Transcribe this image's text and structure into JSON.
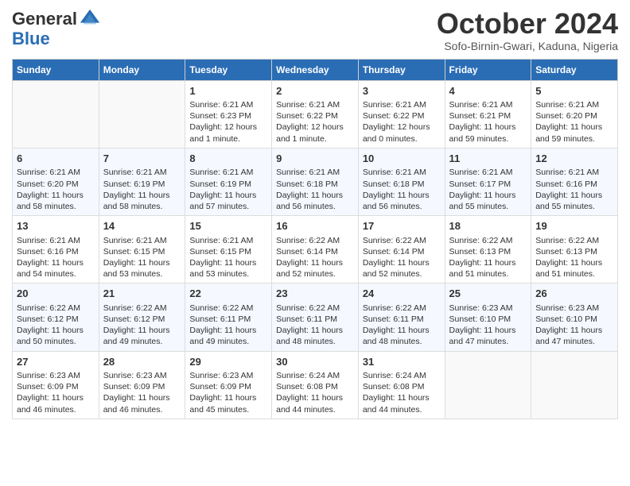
{
  "header": {
    "logo_general": "General",
    "logo_blue": "Blue",
    "month_title": "October 2024",
    "subtitle": "Sofo-Birnin-Gwari, Kaduna, Nigeria"
  },
  "days_of_week": [
    "Sunday",
    "Monday",
    "Tuesday",
    "Wednesday",
    "Thursday",
    "Friday",
    "Saturday"
  ],
  "weeks": [
    [
      {
        "day": null
      },
      {
        "day": null
      },
      {
        "day": 1,
        "sunrise": "Sunrise: 6:21 AM",
        "sunset": "Sunset: 6:23 PM",
        "daylight": "Daylight: 12 hours and 1 minute."
      },
      {
        "day": 2,
        "sunrise": "Sunrise: 6:21 AM",
        "sunset": "Sunset: 6:22 PM",
        "daylight": "Daylight: 12 hours and 1 minute."
      },
      {
        "day": 3,
        "sunrise": "Sunrise: 6:21 AM",
        "sunset": "Sunset: 6:22 PM",
        "daylight": "Daylight: 12 hours and 0 minutes."
      },
      {
        "day": 4,
        "sunrise": "Sunrise: 6:21 AM",
        "sunset": "Sunset: 6:21 PM",
        "daylight": "Daylight: 11 hours and 59 minutes."
      },
      {
        "day": 5,
        "sunrise": "Sunrise: 6:21 AM",
        "sunset": "Sunset: 6:20 PM",
        "daylight": "Daylight: 11 hours and 59 minutes."
      }
    ],
    [
      {
        "day": 6,
        "sunrise": "Sunrise: 6:21 AM",
        "sunset": "Sunset: 6:20 PM",
        "daylight": "Daylight: 11 hours and 58 minutes."
      },
      {
        "day": 7,
        "sunrise": "Sunrise: 6:21 AM",
        "sunset": "Sunset: 6:19 PM",
        "daylight": "Daylight: 11 hours and 58 minutes."
      },
      {
        "day": 8,
        "sunrise": "Sunrise: 6:21 AM",
        "sunset": "Sunset: 6:19 PM",
        "daylight": "Daylight: 11 hours and 57 minutes."
      },
      {
        "day": 9,
        "sunrise": "Sunrise: 6:21 AM",
        "sunset": "Sunset: 6:18 PM",
        "daylight": "Daylight: 11 hours and 56 minutes."
      },
      {
        "day": 10,
        "sunrise": "Sunrise: 6:21 AM",
        "sunset": "Sunset: 6:18 PM",
        "daylight": "Daylight: 11 hours and 56 minutes."
      },
      {
        "day": 11,
        "sunrise": "Sunrise: 6:21 AM",
        "sunset": "Sunset: 6:17 PM",
        "daylight": "Daylight: 11 hours and 55 minutes."
      },
      {
        "day": 12,
        "sunrise": "Sunrise: 6:21 AM",
        "sunset": "Sunset: 6:16 PM",
        "daylight": "Daylight: 11 hours and 55 minutes."
      }
    ],
    [
      {
        "day": 13,
        "sunrise": "Sunrise: 6:21 AM",
        "sunset": "Sunset: 6:16 PM",
        "daylight": "Daylight: 11 hours and 54 minutes."
      },
      {
        "day": 14,
        "sunrise": "Sunrise: 6:21 AM",
        "sunset": "Sunset: 6:15 PM",
        "daylight": "Daylight: 11 hours and 53 minutes."
      },
      {
        "day": 15,
        "sunrise": "Sunrise: 6:21 AM",
        "sunset": "Sunset: 6:15 PM",
        "daylight": "Daylight: 11 hours and 53 minutes."
      },
      {
        "day": 16,
        "sunrise": "Sunrise: 6:22 AM",
        "sunset": "Sunset: 6:14 PM",
        "daylight": "Daylight: 11 hours and 52 minutes."
      },
      {
        "day": 17,
        "sunrise": "Sunrise: 6:22 AM",
        "sunset": "Sunset: 6:14 PM",
        "daylight": "Daylight: 11 hours and 52 minutes."
      },
      {
        "day": 18,
        "sunrise": "Sunrise: 6:22 AM",
        "sunset": "Sunset: 6:13 PM",
        "daylight": "Daylight: 11 hours and 51 minutes."
      },
      {
        "day": 19,
        "sunrise": "Sunrise: 6:22 AM",
        "sunset": "Sunset: 6:13 PM",
        "daylight": "Daylight: 11 hours and 51 minutes."
      }
    ],
    [
      {
        "day": 20,
        "sunrise": "Sunrise: 6:22 AM",
        "sunset": "Sunset: 6:12 PM",
        "daylight": "Daylight: 11 hours and 50 minutes."
      },
      {
        "day": 21,
        "sunrise": "Sunrise: 6:22 AM",
        "sunset": "Sunset: 6:12 PM",
        "daylight": "Daylight: 11 hours and 49 minutes."
      },
      {
        "day": 22,
        "sunrise": "Sunrise: 6:22 AM",
        "sunset": "Sunset: 6:11 PM",
        "daylight": "Daylight: 11 hours and 49 minutes."
      },
      {
        "day": 23,
        "sunrise": "Sunrise: 6:22 AM",
        "sunset": "Sunset: 6:11 PM",
        "daylight": "Daylight: 11 hours and 48 minutes."
      },
      {
        "day": 24,
        "sunrise": "Sunrise: 6:22 AM",
        "sunset": "Sunset: 6:11 PM",
        "daylight": "Daylight: 11 hours and 48 minutes."
      },
      {
        "day": 25,
        "sunrise": "Sunrise: 6:23 AM",
        "sunset": "Sunset: 6:10 PM",
        "daylight": "Daylight: 11 hours and 47 minutes."
      },
      {
        "day": 26,
        "sunrise": "Sunrise: 6:23 AM",
        "sunset": "Sunset: 6:10 PM",
        "daylight": "Daylight: 11 hours and 47 minutes."
      }
    ],
    [
      {
        "day": 27,
        "sunrise": "Sunrise: 6:23 AM",
        "sunset": "Sunset: 6:09 PM",
        "daylight": "Daylight: 11 hours and 46 minutes."
      },
      {
        "day": 28,
        "sunrise": "Sunrise: 6:23 AM",
        "sunset": "Sunset: 6:09 PM",
        "daylight": "Daylight: 11 hours and 46 minutes."
      },
      {
        "day": 29,
        "sunrise": "Sunrise: 6:23 AM",
        "sunset": "Sunset: 6:09 PM",
        "daylight": "Daylight: 11 hours and 45 minutes."
      },
      {
        "day": 30,
        "sunrise": "Sunrise: 6:24 AM",
        "sunset": "Sunset: 6:08 PM",
        "daylight": "Daylight: 11 hours and 44 minutes."
      },
      {
        "day": 31,
        "sunrise": "Sunrise: 6:24 AM",
        "sunset": "Sunset: 6:08 PM",
        "daylight": "Daylight: 11 hours and 44 minutes."
      },
      {
        "day": null
      },
      {
        "day": null
      }
    ]
  ]
}
